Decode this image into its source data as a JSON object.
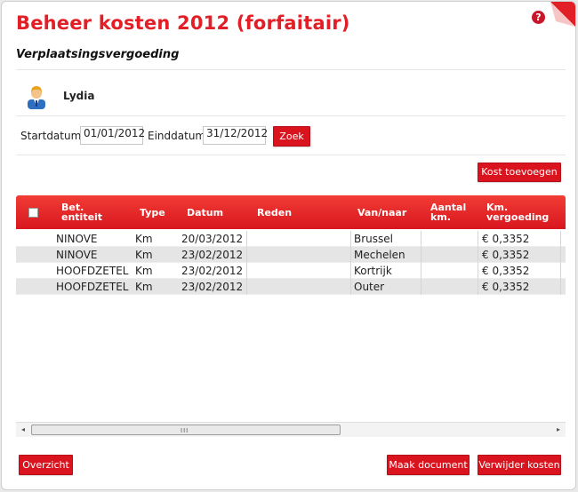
{
  "page": {
    "title": "Beheer kosten 2012 (forfaitair)",
    "subtitle": "Verplaatsingsvergoeding",
    "help_icon": "?"
  },
  "user": {
    "name": "Lydia",
    "avatar_icon": "user-icon"
  },
  "filter": {
    "start_label": "Startdatum",
    "start_value": "01/01/2012",
    "end_label": "Einddatum",
    "end_value": "31/12/2012",
    "search_button": "Zoek"
  },
  "actions": {
    "add_cost": "Kost toevoegen",
    "overview": "Overzicht",
    "make_document": "Maak document",
    "delete_costs": "Verwijder kosten"
  },
  "table": {
    "headers": {
      "entity_1": "Bet.",
      "entity_2": "entiteit",
      "type": "Type",
      "date": "Datum",
      "reason": "Reden",
      "from_to": "Van/naar",
      "km_1": "Aantal",
      "km_2": "km.",
      "fee_1": "Km.",
      "fee_2": "vergoeding"
    },
    "rows": [
      {
        "entity": "NINOVE",
        "type": "Km",
        "date": "20/03/2012",
        "reason": "",
        "place": "Brussel",
        "km": "",
        "fee": "€ 0,3352"
      },
      {
        "entity": "NINOVE",
        "type": "Km",
        "date": "23/02/2012",
        "reason": "",
        "place": "Mechelen",
        "km": "",
        "fee": "€ 0,3352"
      },
      {
        "entity": "HOOFDZETEL",
        "type": "Km",
        "date": "23/02/2012",
        "reason": "",
        "place": "Kortrijk",
        "km": "",
        "fee": "€ 0,3352"
      },
      {
        "entity": "HOOFDZETEL",
        "type": "Km",
        "date": "23/02/2012",
        "reason": "",
        "place": "Outer",
        "km": "",
        "fee": "€ 0,3352"
      }
    ]
  },
  "scrollbar": {
    "left_arrow": "◂",
    "right_arrow": "▸",
    "grip": "III"
  },
  "colors": {
    "accent": "#e21f26",
    "button": "#d9141f"
  }
}
